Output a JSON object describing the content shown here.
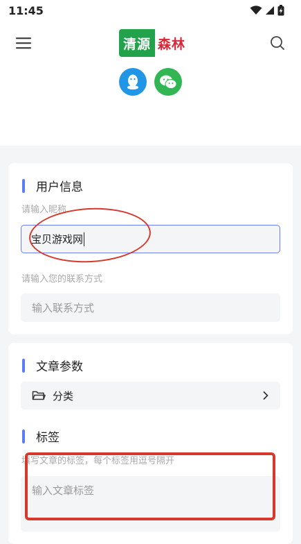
{
  "status_bar": {
    "time": "11:45"
  },
  "header": {
    "logo_green": "清源",
    "logo_red": "森林"
  },
  "social": {
    "qq_icon": "qq-icon",
    "wechat_icon": "wechat-icon"
  },
  "user_info": {
    "title": "用户信息",
    "nickname_hint": "请输入昵称",
    "nickname_value": "宝贝游戏网",
    "contact_hint": "请输入您的联系方式",
    "contact_placeholder": "输入联系方式"
  },
  "article_params": {
    "title": "文章参数",
    "category_label": "分类",
    "tags_title": "标签",
    "tags_hint": "填写文章的标签，每个标签用逗号隔开",
    "tags_placeholder": "输入文章标签"
  },
  "colors": {
    "accent": "#5b7cf7",
    "annotation": "#d6392c",
    "logo_green": "#22a24a",
    "logo_red": "#d9283a"
  }
}
